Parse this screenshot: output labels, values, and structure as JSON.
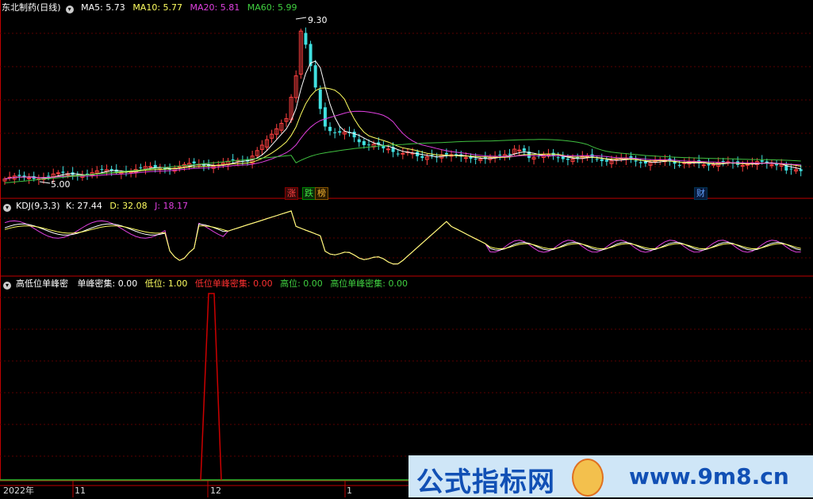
{
  "main_header": {
    "stock": "东北制药(日线)",
    "ma5_label": "MA5: 5.73",
    "ma10_label": "MA10: 5.77",
    "ma20_label": "MA20: 5.81",
    "ma60_label": "MA60: 5.99"
  },
  "price_annotations": {
    "high": "9.30",
    "low": "5.00"
  },
  "badges": [
    {
      "label": "涨",
      "color": "#e03030"
    },
    {
      "label": "跌",
      "color": "#30c030"
    },
    {
      "label": "榜",
      "color": "#e0a020"
    },
    {
      "label": "财",
      "color": "#3080ff"
    }
  ],
  "kdj_header": {
    "title": "KDJ(9,3,3)",
    "k_label": "K: 27.44",
    "d_label": "D: 32.08",
    "j_label": "J: 18.17"
  },
  "ind_header": {
    "title": "高低位单峰密",
    "s1_label": "单峰密集: 0.00",
    "s2_label": "低位: 1.00",
    "s3_label": "低位单峰密集: 0.00",
    "s4_label": "高位: 0.00",
    "s5_label": "高位单峰密集: 0.00"
  },
  "x_axis": [
    "2022年",
    "11",
    "12",
    "1"
  ],
  "watermark": {
    "text": "公式指标网",
    "url": "www.9m8.cn"
  },
  "colors": {
    "up": "#ff4040",
    "down": "#40e0e0",
    "ma5": "#ffffff",
    "ma10": "#ffff60",
    "ma20": "#e040e0",
    "ma60": "#40c040",
    "red_line": "#cc0000"
  },
  "chart_data": {
    "type": "candlestick",
    "ma_series": [
      "MA5",
      "MA10",
      "MA20",
      "MA60"
    ],
    "price_high": 9.3,
    "price_low": 5.0,
    "last_ma": {
      "MA5": 5.73,
      "MA10": 5.77,
      "MA20": 5.81,
      "MA60": 5.99
    },
    "kdj_last": {
      "K": 27.44,
      "D": 32.08,
      "J": 18.17
    },
    "indicator_last": {
      "单峰密集": 0.0,
      "低位": 1.0,
      "低位单峰密集": 0.0,
      "高位": 0.0,
      "高位单峰密集": 0.0
    }
  }
}
